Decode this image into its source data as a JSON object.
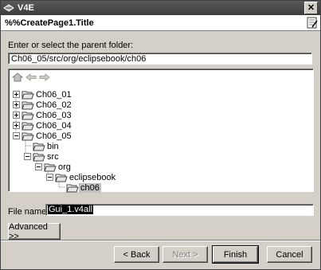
{
  "window": {
    "title": "V4E",
    "close_glyph": "✕"
  },
  "header": {
    "title": "%%CreatePage1.Title"
  },
  "parent_folder": {
    "prompt": "Enter or select the parent folder:",
    "value": "Ch06_05/src/org/eclipsebook/ch06"
  },
  "tree": {
    "toolbar_icons": [
      "home-icon",
      "back-arrow-icon",
      "forward-arrow-icon"
    ],
    "nodes": [
      {
        "label": "Ch06_01",
        "depth": 0,
        "expander": "+"
      },
      {
        "label": "Ch06_02",
        "depth": 0,
        "expander": "+"
      },
      {
        "label": "Ch06_03",
        "depth": 0,
        "expander": "+"
      },
      {
        "label": "Ch06_04",
        "depth": 0,
        "expander": "+"
      },
      {
        "label": "Ch06_05",
        "depth": 0,
        "expander": "-"
      },
      {
        "label": "bin",
        "depth": 1,
        "expander": ""
      },
      {
        "label": "src",
        "depth": 1,
        "expander": "-"
      },
      {
        "label": "org",
        "depth": 2,
        "expander": "-"
      },
      {
        "label": "eclipsebook",
        "depth": 3,
        "expander": "-"
      },
      {
        "label": "ch06",
        "depth": 4,
        "expander": "",
        "selected": true
      }
    ]
  },
  "file_name": {
    "label": "File name:",
    "value": "Gui_1.v4all"
  },
  "buttons": {
    "advanced": "Advanced >>",
    "back": "< Back",
    "next": "Next >",
    "finish": "Finish",
    "cancel": "Cancel"
  }
}
